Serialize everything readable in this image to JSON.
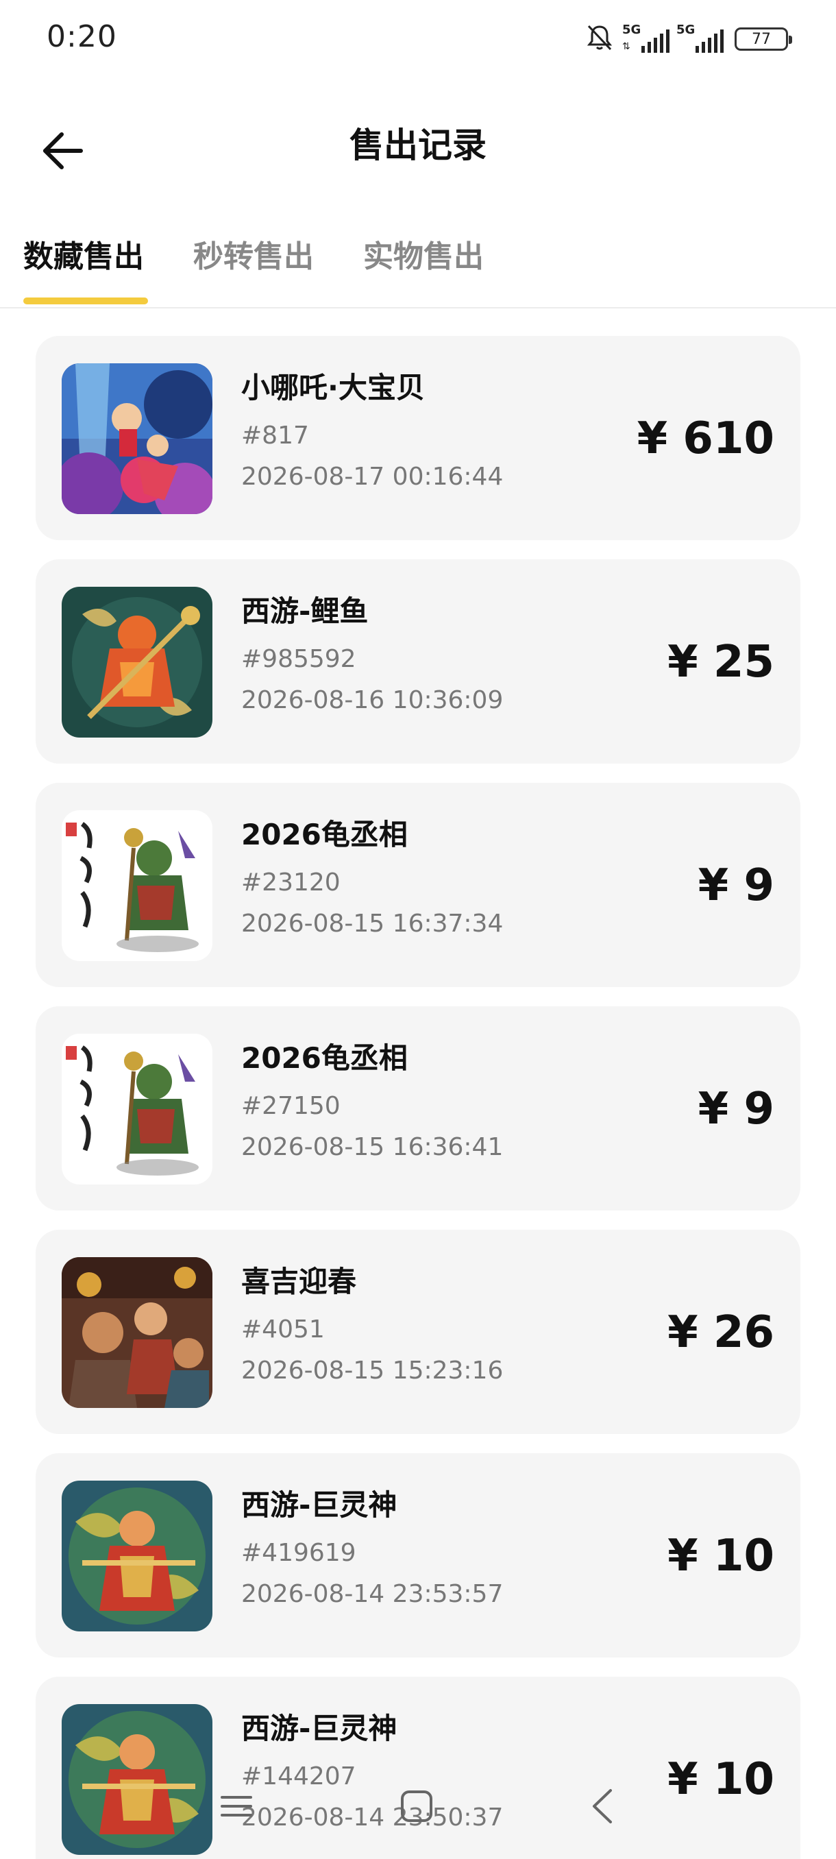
{
  "status": {
    "time": "0:20",
    "net1": "5G",
    "net2": "5G",
    "battery": "77"
  },
  "header": {
    "title": "售出记录"
  },
  "tabs": [
    {
      "label": "数藏售出",
      "active": true
    },
    {
      "label": "秒转售出",
      "active": false
    },
    {
      "label": "实物售出",
      "active": false
    }
  ],
  "accent_color": "#f4cb3e",
  "records": [
    {
      "name": "小哪吒·大宝贝",
      "serial": "#817",
      "time": "2026-08-17 00:16:44",
      "price": "¥ 610"
    },
    {
      "name": "西游-鲤鱼",
      "serial": "#985592",
      "time": "2026-08-16 10:36:09",
      "price": "¥ 25"
    },
    {
      "name": "2026龟丞相",
      "serial": "#23120",
      "time": "2026-08-15 16:37:34",
      "price": "¥ 9"
    },
    {
      "name": "2026龟丞相",
      "serial": "#27150",
      "time": "2026-08-15 16:36:41",
      "price": "¥ 9"
    },
    {
      "name": "喜吉迎春",
      "serial": "#4051",
      "time": "2026-08-15 15:23:16",
      "price": "¥ 26"
    },
    {
      "name": "西游-巨灵神",
      "serial": "#419619",
      "time": "2026-08-14 23:53:57",
      "price": "¥ 10"
    },
    {
      "name": "西游-巨灵神",
      "serial": "#144207",
      "time": "2026-08-14 23:50:37",
      "price": "¥ 10"
    }
  ]
}
